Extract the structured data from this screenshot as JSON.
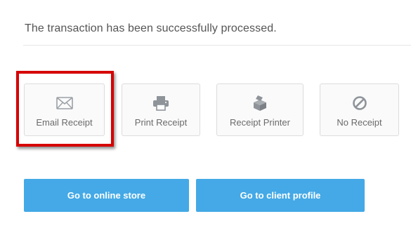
{
  "message": "The transaction has been successfully processed.",
  "receipt_options": {
    "email": {
      "label": "Email Receipt",
      "icon": "envelope-icon"
    },
    "print": {
      "label": "Print Receipt",
      "icon": "printer-icon"
    },
    "printer": {
      "label": "Receipt Printer",
      "icon": "box-icon"
    },
    "none": {
      "label": "No Receipt",
      "icon": "no-symbol-icon"
    }
  },
  "buttons": {
    "online_store": "Go to online store",
    "client_profile": "Go to client profile"
  },
  "colors": {
    "primary_button": "#44a9e6",
    "highlight": "#d60000",
    "icon_gray": "#9aa0a6"
  }
}
